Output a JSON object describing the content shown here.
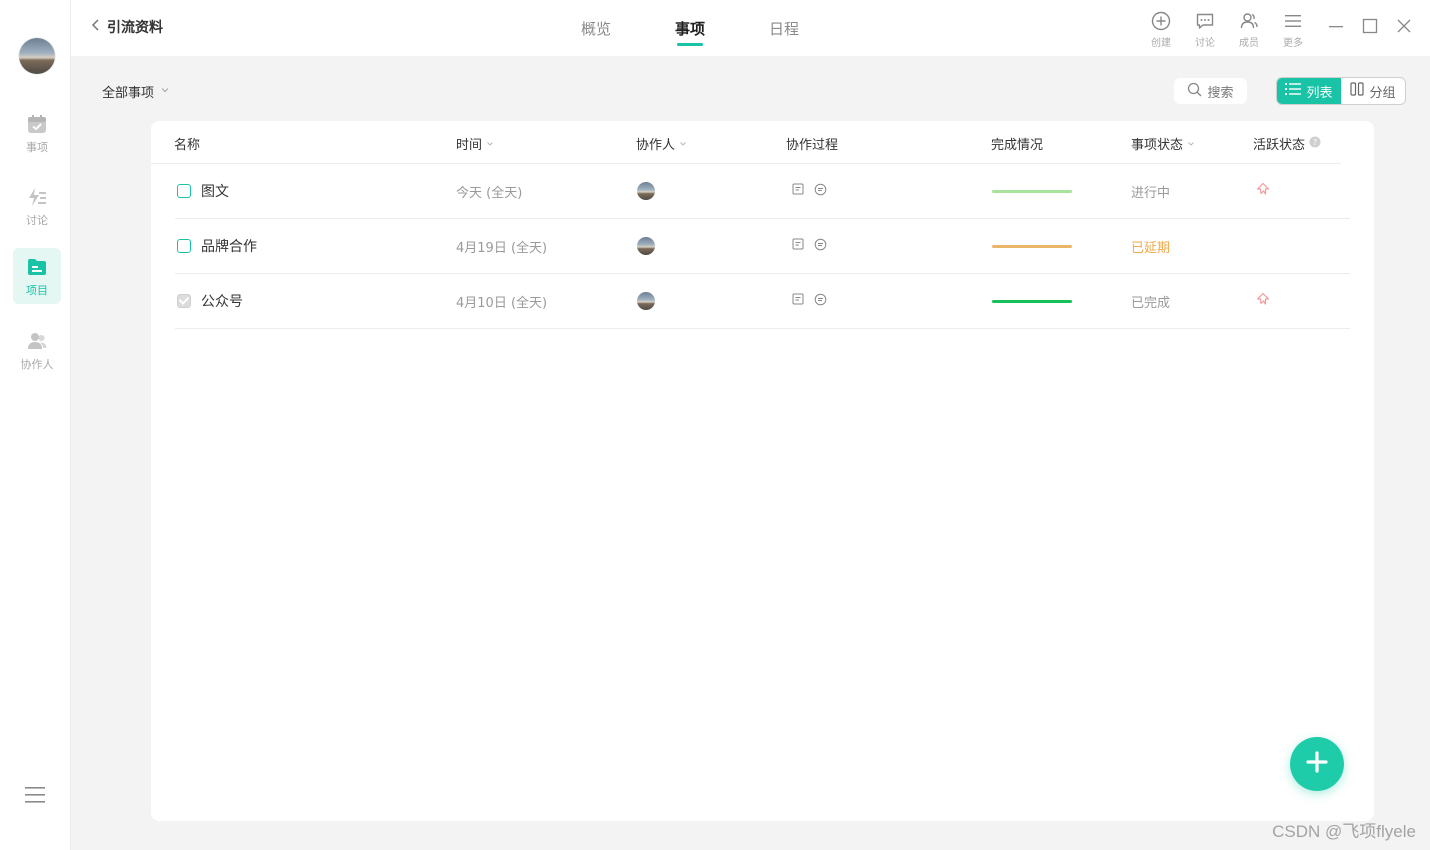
{
  "sidebar": {
    "items": [
      {
        "label": "事项",
        "icon": "calendar-check-icon",
        "active": false
      },
      {
        "label": "讨论",
        "icon": "discussion-icon",
        "active": false
      },
      {
        "label": "项目",
        "icon": "folder-icon",
        "active": true
      },
      {
        "label": "协作人",
        "icon": "people-icon",
        "active": false
      }
    ]
  },
  "header": {
    "back_title": "引流资料",
    "tabs": [
      {
        "label": "概览",
        "active": false
      },
      {
        "label": "事项",
        "active": true
      },
      {
        "label": "日程",
        "active": false
      }
    ],
    "tools": [
      {
        "label": "创建",
        "icon": "plus-circle-icon"
      },
      {
        "label": "讨论",
        "icon": "chat-icon"
      },
      {
        "label": "成员",
        "icon": "members-icon"
      },
      {
        "label": "更多",
        "icon": "menu-icon"
      }
    ]
  },
  "toolbar": {
    "filter_label": "全部事项",
    "search_label": "搜索",
    "view_list": "列表",
    "view_group": "分组"
  },
  "table": {
    "columns": {
      "name": "名称",
      "time": "时间",
      "collaborator": "协作人",
      "process": "协作过程",
      "completion": "完成情况",
      "status": "事项状态",
      "activity": "活跃状态"
    },
    "rows": [
      {
        "name": "图文",
        "date": "今天 (全天)",
        "completion_color": "#a9e29a",
        "status": "进行中",
        "status_color": "#9a9a9a",
        "done": false,
        "activity_icon": true
      },
      {
        "name": "品牌合作",
        "date": "4月19日 (全天)",
        "completion_color": "#ebb567",
        "status": "已延期",
        "status_color": "#f0a94b",
        "done": false,
        "activity_icon": false
      },
      {
        "name": "公众号",
        "date": "4月10日 (全天)",
        "completion_color": "#17c15a",
        "status": "已完成",
        "status_color": "#9a9a9a",
        "done": true,
        "activity_icon": true
      }
    ]
  },
  "colors": {
    "accent": "#19c3a6",
    "fab": "#1fcca9",
    "delayed": "#f0a94b"
  },
  "watermark": "CSDN @飞项flyele"
}
